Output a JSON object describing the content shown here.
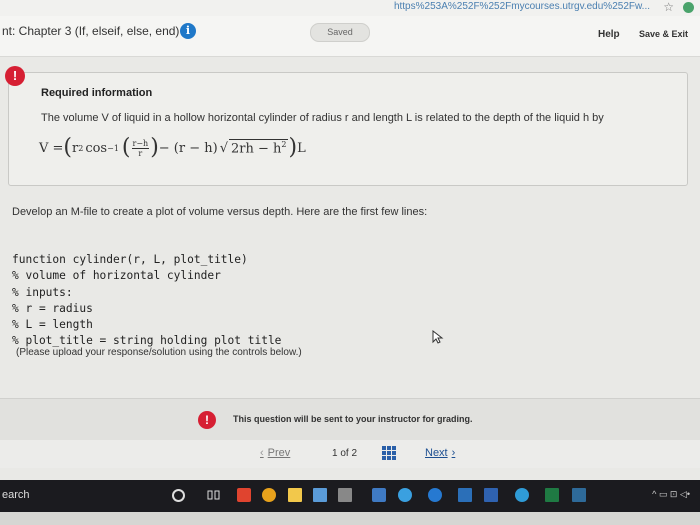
{
  "browser": {
    "url_fragment": "https%253A%252F%252Fmycourses.utrgv.edu%252Fw...",
    "star": "☆"
  },
  "header": {
    "title": "nt: Chapter 3 (If, elseif, else, end)",
    "info": "i",
    "saved": "Saved",
    "help": "Help",
    "save_exit": "Save & Exit"
  },
  "required": {
    "alert": "!",
    "heading": "Required information",
    "text": "The volume V of liquid in a hollow horizontal cylinder of radius r and length L is related to the depth of the liquid h by",
    "formula": {
      "lhs": "V = ",
      "r2cos": "r",
      "cos": "cos",
      "inv": "−1",
      "frac_num": "r−h",
      "frac_den": "r",
      "minus": " − (r − h)",
      "sqrt": "2rh − h",
      "sq": "2",
      "tail": " L"
    }
  },
  "main": {
    "prompt": "Develop an M-file to create a plot of volume versus depth. Here are the first few lines:",
    "code": [
      "function cylinder(r, L, plot_title)",
      "% volume of horizontal cylinder",
      "% inputs:",
      "% r = radius",
      "% L = length",
      "% plot_title = string holding plot title"
    ],
    "upload_note": "(Please upload your response/solution using the controls below.)"
  },
  "footer": {
    "alert": "!",
    "grading": "This question will be sent to your instructor for grading."
  },
  "nav": {
    "prev": "Prev",
    "page": "1 of 2",
    "next": "Next"
  },
  "taskbar": {
    "search": "earch"
  },
  "colors": {
    "accent": "#1f78c8",
    "alert": "#d61f33",
    "link": "#1d4f91"
  }
}
